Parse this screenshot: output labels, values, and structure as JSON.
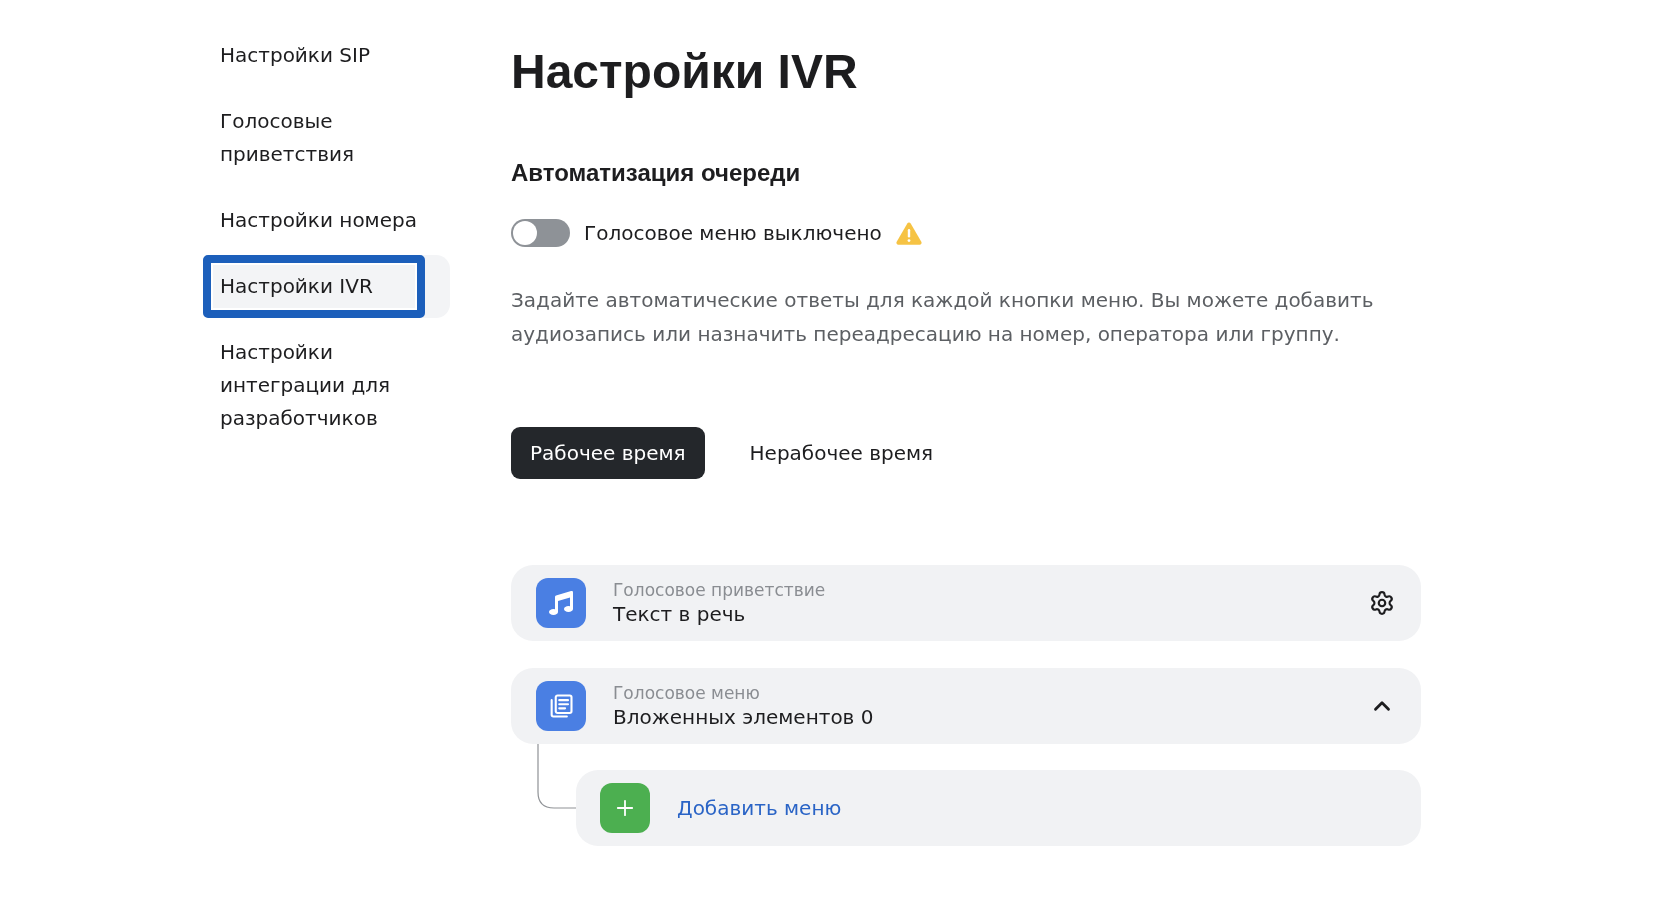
{
  "sidebar": {
    "items": [
      {
        "label": "Настройки SIP",
        "selected": false
      },
      {
        "label": "Голосовые приветствия",
        "selected": false
      },
      {
        "label": "Настройки номера",
        "selected": false
      },
      {
        "label": "Настройки IVR",
        "selected": true
      },
      {
        "label": "Настройки интеграции для разработчиков",
        "selected": false
      }
    ]
  },
  "page_title": "Настройки IVR",
  "section": {
    "title": "Автоматизация очереди",
    "toggle": {
      "label": "Голосовое меню выключено",
      "on": false,
      "warning": true
    },
    "description": "Задайте автоматические ответы для каждой кнопки меню. Вы можете добавить аудиозапись или назначить переадресацию на номер, оператора или группу."
  },
  "schedule_tabs": [
    {
      "label": "Рабочее время",
      "selected": true
    },
    {
      "label": "Нерабочее время",
      "selected": false
    }
  ],
  "flow": [
    {
      "kind": "greeting",
      "caption": "Голосовое приветствие",
      "value": "Текст в речь"
    },
    {
      "kind": "menu",
      "caption": "Голосовое меню",
      "value": "Вложенных элементов 0",
      "expanded": true,
      "children": [
        {
          "kind": "add",
          "label": "Добавить меню"
        }
      ]
    }
  ]
}
